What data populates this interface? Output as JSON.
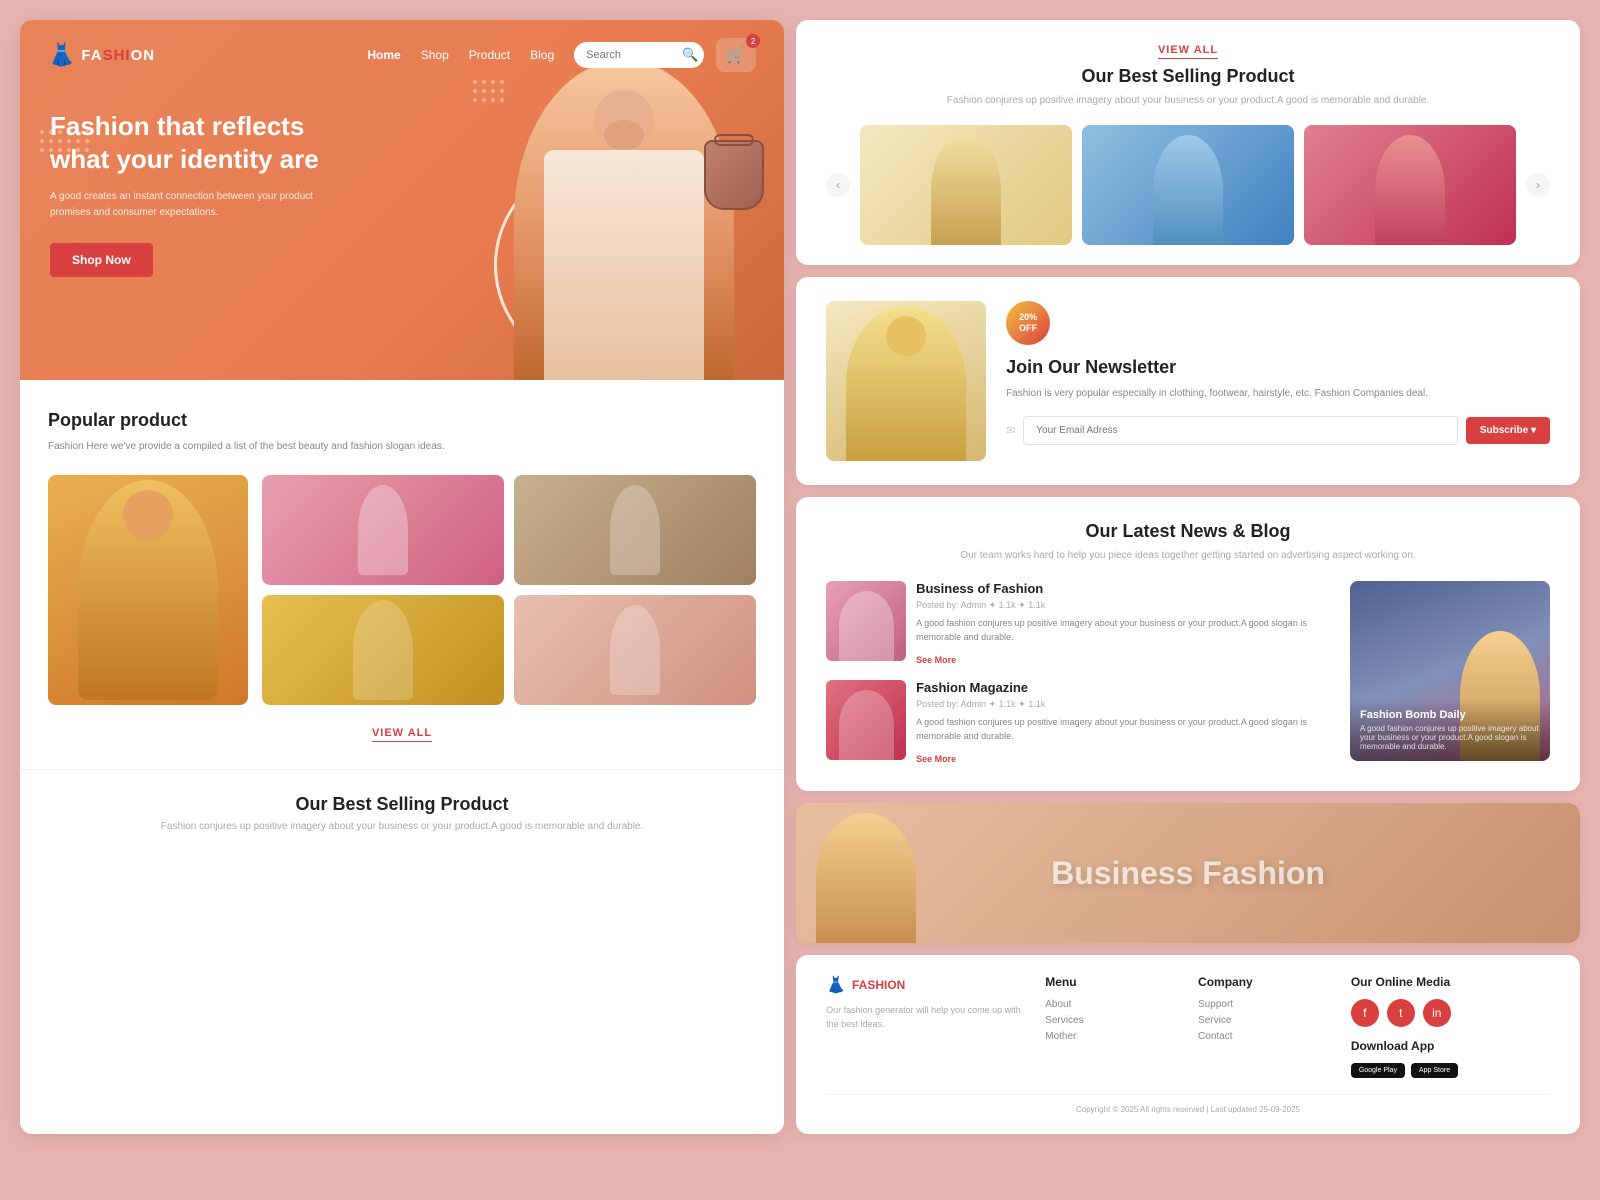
{
  "brand": {
    "name": "FASHION",
    "logo_icon": "👗"
  },
  "nav": {
    "links": [
      "Home",
      "Shop",
      "Product",
      "Blog"
    ],
    "active": "Home",
    "search_placeholder": "Search",
    "cart_badge": "2"
  },
  "hero": {
    "title": "Fashion that reflects what your identity are",
    "subtitle": "A good creates an instant connection between your product promises and consumer expectations.",
    "cta_label": "Shop Now"
  },
  "popular": {
    "title": "Popular product",
    "desc": "Fashion Here we've provide a compiled a list of the best beauty and fashion slogan ideas.",
    "view_all": "VIEW ALL"
  },
  "best_selling": {
    "title": "Our Best Selling Product",
    "desc": "Fashion conjures up positive imagery about your business or your product.A good is memorable and durable.",
    "view_all": "VIEW ALL"
  },
  "newsletter": {
    "title": "Join Our Newsletter",
    "desc": "Fashion is very popular especially in clothing, footwear, hairstyle, etc. Fashion Companies deal.",
    "badge_line1": "20%",
    "badge_line2": "OFF",
    "email_placeholder": "Your Email Adress",
    "subscribe_label": "Subscribe ▾"
  },
  "latest_news": {
    "title": "Our Latest News & Blog",
    "desc": "Our team works hard to help you piece ideas together getting started on advertising aspect working on.",
    "articles": [
      {
        "title": "Business of Fashion",
        "meta": "Posted by: Admin  ✦ 1.1k  ✦ 1.1k",
        "excerpt": "A good fashion conjures up positive imagery about your business or your product.A good slogan is memorable and durable.",
        "see_more": "See More"
      },
      {
        "title": "Fashion Magazine",
        "meta": "Posted by: Admin  ✦ 1.1k  ✦ 1.1k",
        "excerpt": "A good fashion conjures up positive imagery about your business or your product.A good slogan is memorable and durable.",
        "see_more": "See More"
      }
    ],
    "featured": {
      "title": "Fashion Bomb Daily",
      "desc": "A good fashion conjures up positive imagery about your business or your product.A good slogan is memorable and durable."
    }
  },
  "business_fashion": {
    "text": "Business Fashion"
  },
  "footer": {
    "brand_name": "FASHION",
    "brand_desc": "Our fashion generator will help you come up with the best ideas.",
    "menu_title": "Menu",
    "menu_links": [
      "About",
      "Services",
      "Mother"
    ],
    "company_title": "Company",
    "company_links": [
      "Support",
      "Service",
      "Contact"
    ],
    "social_title": "Our Online Media",
    "social_icons": [
      "f",
      "t",
      "in"
    ],
    "app_title": "Download App",
    "google_play": "Google Play",
    "app_store": "App Store",
    "copyright": "Copyright © 2025 All rights reserved | Last updated 25-09-2025"
  }
}
